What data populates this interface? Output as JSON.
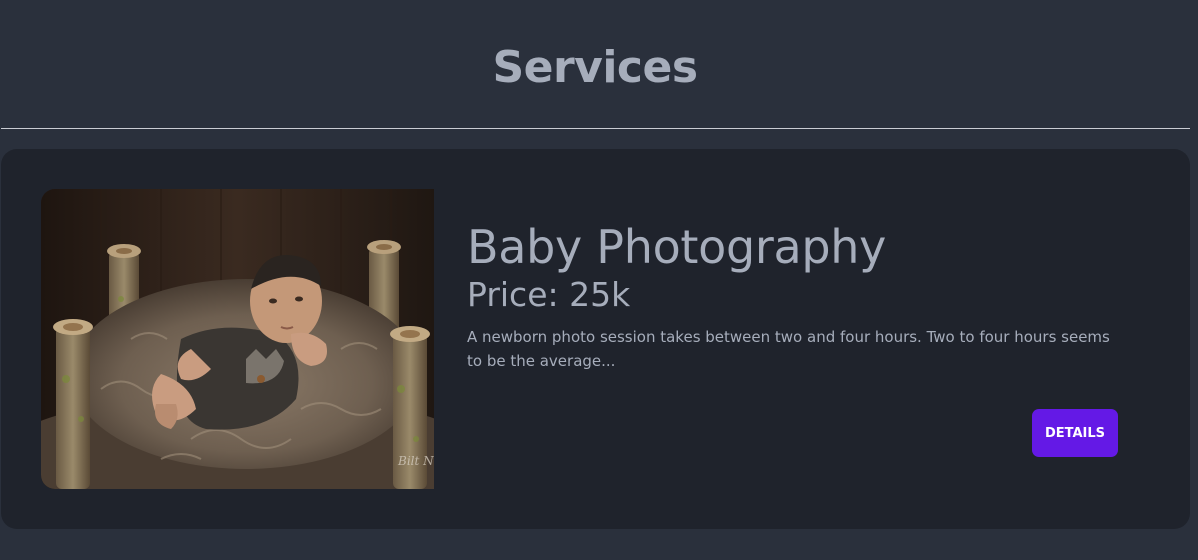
{
  "header": {
    "title": "Services"
  },
  "service": {
    "name": "Baby Photography",
    "price": "Price: 25k",
    "description": "A newborn photo session takes between two and four hours. Two to four hours seems to be the average...",
    "details_label": "DETAILS",
    "image_alt": "newborn baby in a wooden crib with fur blanket",
    "watermark": "Bilt Nat"
  },
  "colors": {
    "page_background": "#2a303c",
    "card_background": "#1f232c",
    "text": "#a6adbb",
    "button": "#6419e6",
    "button_text": "#ffffff",
    "divider": "#c9ccd3"
  }
}
